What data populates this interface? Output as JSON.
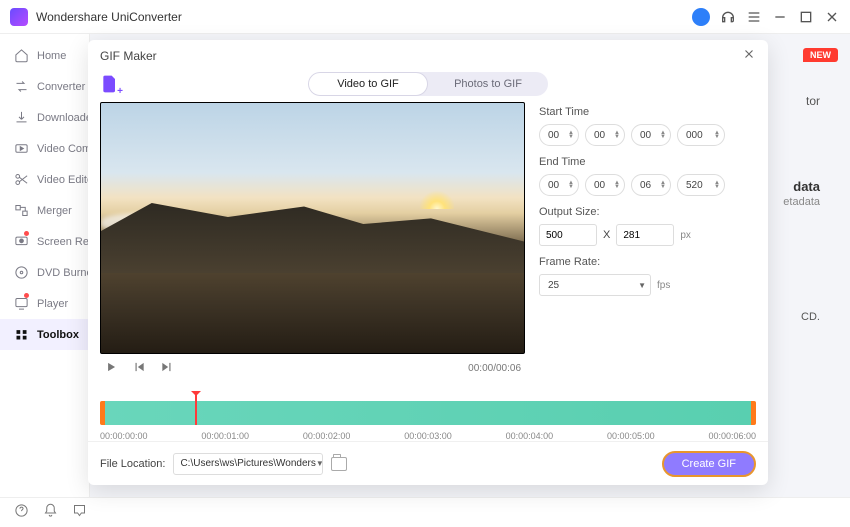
{
  "app": {
    "title": "Wondershare UniConverter"
  },
  "sidebar": {
    "items": [
      {
        "label": "Home",
        "icon": "home-icon"
      },
      {
        "label": "Converter",
        "icon": "convert-icon"
      },
      {
        "label": "Downloader",
        "icon": "download-icon"
      },
      {
        "label": "Video Compressor",
        "icon": "compress-icon"
      },
      {
        "label": "Video Editor",
        "icon": "scissors-icon"
      },
      {
        "label": "Merger",
        "icon": "merge-icon"
      },
      {
        "label": "Screen Recorder",
        "icon": "record-icon"
      },
      {
        "label": "DVD Burner",
        "icon": "dvd-icon"
      },
      {
        "label": "Player",
        "icon": "player-icon"
      },
      {
        "label": "Toolbox",
        "icon": "toolbox-icon"
      }
    ]
  },
  "background": {
    "new_badge": "NEW",
    "w1": "tor",
    "w2": "data",
    "w3": "etadata",
    "w4": "CD."
  },
  "modal": {
    "title": "GIF Maker",
    "tabs": {
      "video": "Video to GIF",
      "photo": "Photos to GIF"
    },
    "time_display": "00:00/00:06",
    "start_label": "Start Time",
    "start": [
      "00",
      "00",
      "00",
      "000"
    ],
    "end_label": "End Time",
    "end": [
      "00",
      "00",
      "06",
      "520"
    ],
    "output_label": "Output Size:",
    "out_w": "500",
    "out_x": "X",
    "out_h": "281",
    "px": "px",
    "fr_label": "Frame Rate:",
    "fr_value": "25",
    "fr_unit": "fps",
    "ticks": [
      "00:00:00:00",
      "00:00:01:00",
      "00:00:02:00",
      "00:00:03:00",
      "00:00:04:00",
      "00:00:05:00",
      "00:00:06:00"
    ],
    "file_loc_label": "File Location:",
    "file_loc": "C:\\Users\\ws\\Pictures\\Wonders",
    "create": "Create GIF"
  }
}
